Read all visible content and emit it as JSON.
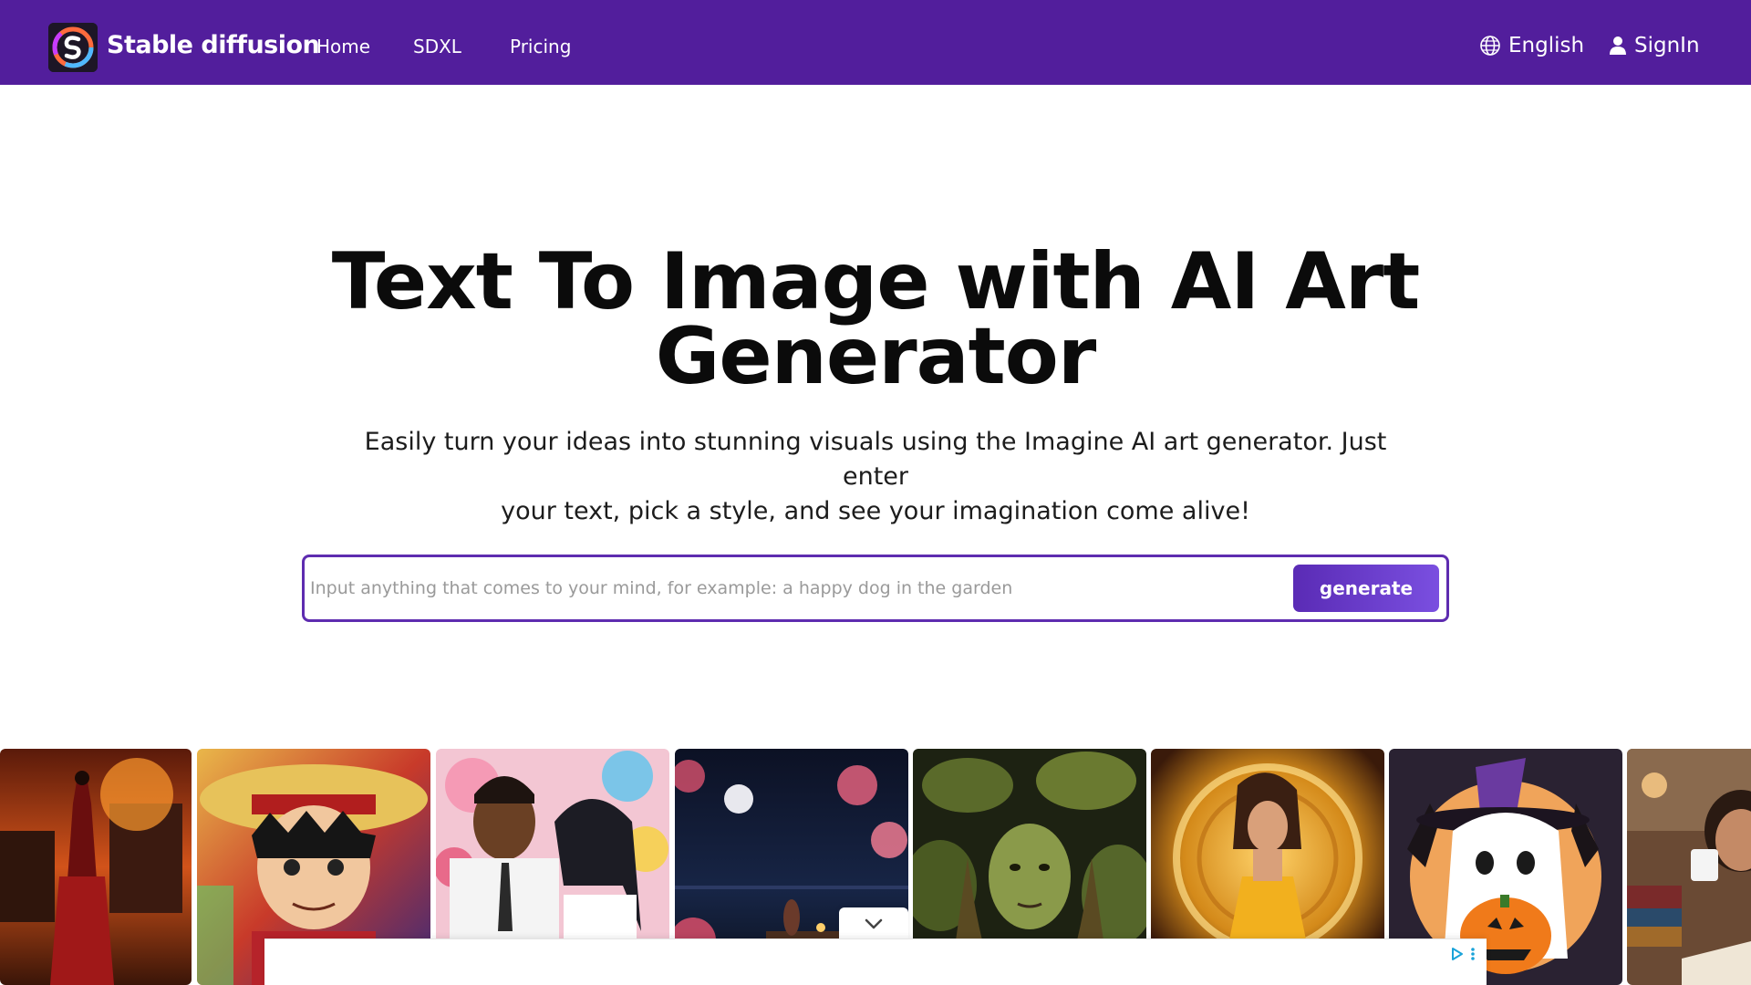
{
  "brand": {
    "name": "Stable diffusion",
    "logo_icon": "stable-diffusion-logo"
  },
  "nav": {
    "links": [
      {
        "label": "Home"
      },
      {
        "label": "SDXL"
      },
      {
        "label": "Pricing"
      }
    ],
    "language": {
      "label": "English",
      "icon": "globe-icon"
    },
    "signin": {
      "label": "SignIn",
      "icon": "user-icon"
    }
  },
  "hero": {
    "title_line1": "Text To Image with AI Art",
    "title_line2": "Generator",
    "subtitle_line1": "Easily turn your ideas into stunning visuals using the Imagine AI art generator. Just enter",
    "subtitle_line2": "your text, pick a style, and see your imagination come alive!"
  },
  "search": {
    "placeholder": "Input anything that comes to your mind, for example: a happy dog in the garden",
    "value": "",
    "button_label": "generate"
  },
  "gallery": {
    "items": [
      {
        "subject": "woman in red dress before burning fortress"
      },
      {
        "subject": "anime pirate with straw hat"
      },
      {
        "subject": "anime couple with flowers"
      },
      {
        "subject": "night sea with moon and flowers"
      },
      {
        "subject": "green forest spirit woman"
      },
      {
        "subject": "woman in yellow dress with golden disc"
      },
      {
        "subject": "ghost with witch hat and pumpkin"
      },
      {
        "subject": "woman drinking coffee with books"
      }
    ]
  },
  "ad": {
    "collapse_icon": "chevron-down-icon",
    "adchoices_icon": "adchoices-icon",
    "menu_icon": "more-vertical-icon"
  },
  "colors": {
    "nav_bg": "#521e9c",
    "accent": "#5e2cb0",
    "button_gradient_end": "#7a4fe0"
  }
}
